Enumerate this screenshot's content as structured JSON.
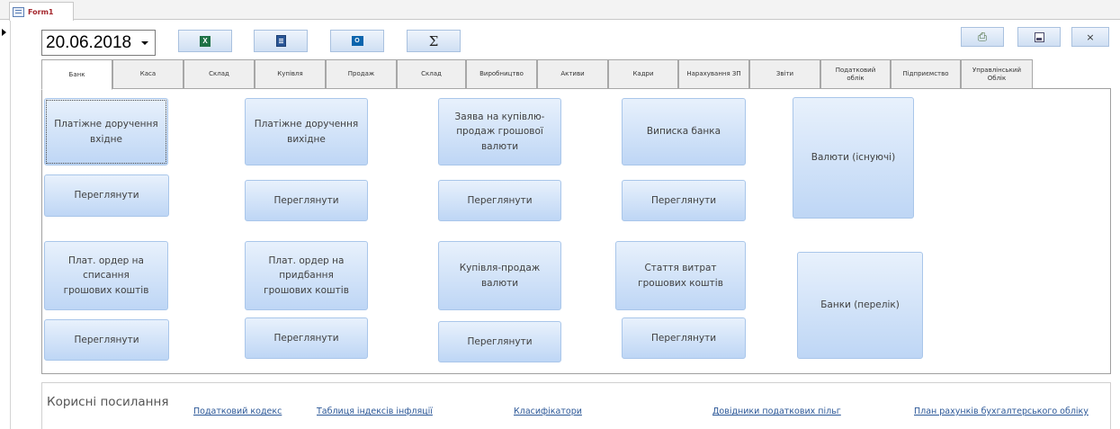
{
  "document_tab": {
    "label": "Form1"
  },
  "toolbar": {
    "date_value": "20.06.2018",
    "excel_icon": "excel-icon",
    "word_icon": "word-icon",
    "outlook_icon": "outlook-icon",
    "sigma_symbol": "Σ",
    "print_icon": "print-icon",
    "save_icon": "save-icon",
    "close_symbol": "×"
  },
  "tabs": [
    {
      "label": "Банк",
      "active": true
    },
    {
      "label": "Каса"
    },
    {
      "label": "Склад"
    },
    {
      "label": "Купівля"
    },
    {
      "label": "Продаж"
    },
    {
      "label": "Склад"
    },
    {
      "label": "Виробництво"
    },
    {
      "label": "Активи"
    },
    {
      "label": "Кадри"
    },
    {
      "label": "Нарахування ЗП"
    },
    {
      "label": "Звіти"
    },
    {
      "label": "Податковий облік"
    },
    {
      "label": "Підприємство"
    },
    {
      "label": "Управлінський Облік"
    }
  ],
  "bank_panel": {
    "incoming_payment_order": "Платіжне доручення вхідне",
    "outgoing_payment_order": "Платіжне доручення вихідне",
    "fx_request": "Заява на купівлю-продаж грошової валюти",
    "bank_statement": "Виписка банка",
    "currencies": "Валюти (існуючі)",
    "view": "Переглянути",
    "writeoff_order": "Плат. ордер на списання грошових коштів",
    "purchase_order": "Плат. ордер на придбання грошових коштів",
    "fx_trade": "Купівля-продаж валюти",
    "expense_items": "Стаття витрат грошових коштів",
    "banks_list": "Банки (перелік)"
  },
  "links": {
    "title": "Корисні посилання",
    "tax_code": "Податковий кодекс",
    "inflation_table": "Таблиця індексів інфляції",
    "classifiers": "Класифікатори",
    "tax_benefits": "Довідники податкових пільг",
    "chart_of_accounts": "План рахунків бухгалтерського обліку"
  }
}
